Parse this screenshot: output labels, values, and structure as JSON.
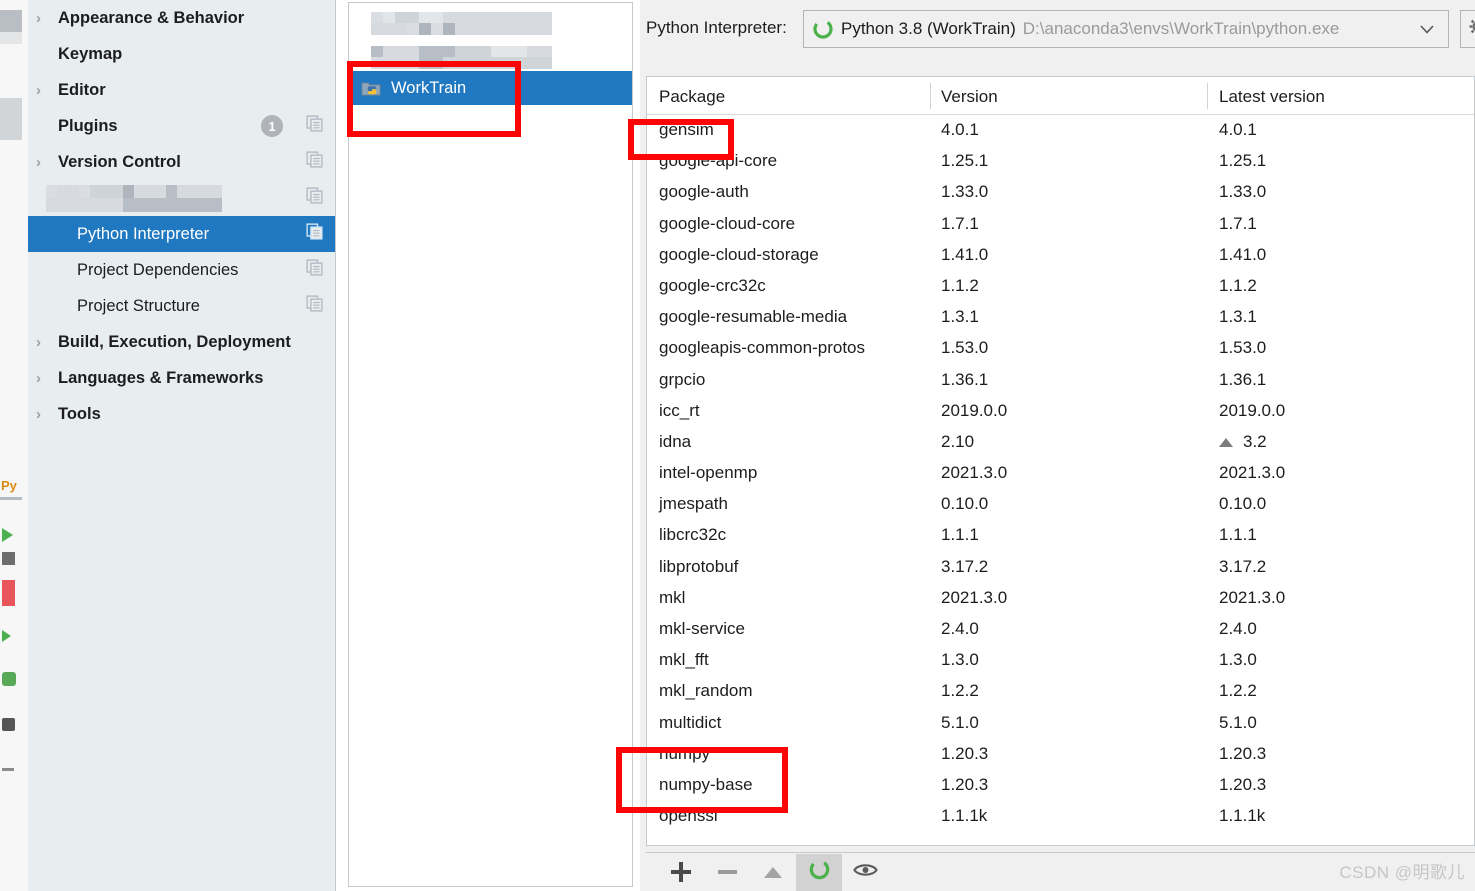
{
  "settings_tree": {
    "items": [
      {
        "label": "Appearance & Behavior",
        "level": "top",
        "expandable": true,
        "copy_icon": false,
        "badge": null,
        "redacted": false,
        "selected": false
      },
      {
        "label": "Keymap",
        "level": "top",
        "expandable": false,
        "copy_icon": false,
        "badge": null,
        "redacted": false,
        "selected": false
      },
      {
        "label": "Editor",
        "level": "top",
        "expandable": true,
        "copy_icon": false,
        "badge": null,
        "redacted": false,
        "selected": false
      },
      {
        "label": "Plugins",
        "level": "top",
        "expandable": false,
        "copy_icon": true,
        "badge": "1",
        "redacted": false,
        "selected": false
      },
      {
        "label": "Version Control",
        "level": "top",
        "expandable": true,
        "copy_icon": true,
        "badge": null,
        "redacted": false,
        "selected": false
      },
      {
        "label": "",
        "level": "top",
        "expandable": false,
        "copy_icon": true,
        "badge": null,
        "redacted": true,
        "selected": false
      },
      {
        "label": "Python Interpreter",
        "level": "child",
        "expandable": false,
        "copy_icon": true,
        "badge": null,
        "redacted": false,
        "selected": true
      },
      {
        "label": "Project Dependencies",
        "level": "child",
        "expandable": false,
        "copy_icon": true,
        "badge": null,
        "redacted": false,
        "selected": false
      },
      {
        "label": "Project Structure",
        "level": "child",
        "expandable": false,
        "copy_icon": true,
        "badge": null,
        "redacted": false,
        "selected": false
      },
      {
        "label": "Build, Execution, Deployment",
        "level": "top",
        "expandable": true,
        "copy_icon": false,
        "badge": null,
        "redacted": false,
        "selected": false
      },
      {
        "label": "Languages & Frameworks",
        "level": "top",
        "expandable": true,
        "copy_icon": false,
        "badge": null,
        "redacted": false,
        "selected": false
      },
      {
        "label": "Tools",
        "level": "top",
        "expandable": true,
        "copy_icon": false,
        "badge": null,
        "redacted": false,
        "selected": false
      }
    ],
    "chevron_glyph": "›"
  },
  "env_panel": {
    "items": [
      {
        "label": "",
        "redacted": true,
        "selected": false,
        "icon": null
      },
      {
        "label": "",
        "redacted": true,
        "selected": false,
        "icon": null
      },
      {
        "label": "WorkTrain",
        "redacted": false,
        "selected": true,
        "icon": "python-env-icon"
      }
    ]
  },
  "interpreter": {
    "label": "Python Interpreter:",
    "icon": "conda-ring-icon",
    "name": "Python 3.8 (WorkTrain)",
    "path": "D:\\anaconda3\\envs\\WorkTrain\\python.exe",
    "dropdown_arrow": "∨",
    "gear_button_icon": "gear-icon"
  },
  "packages_table": {
    "columns": [
      "Package",
      "Version",
      "Latest version"
    ],
    "rows": [
      {
        "package": "gensim",
        "version": "4.0.1",
        "latest": "4.0.1",
        "upgradable": false
      },
      {
        "package": "google-api-core",
        "version": "1.25.1",
        "latest": "1.25.1",
        "upgradable": false
      },
      {
        "package": "google-auth",
        "version": "1.33.0",
        "latest": "1.33.0",
        "upgradable": false
      },
      {
        "package": "google-cloud-core",
        "version": "1.7.1",
        "latest": "1.7.1",
        "upgradable": false
      },
      {
        "package": "google-cloud-storage",
        "version": "1.41.0",
        "latest": "1.41.0",
        "upgradable": false
      },
      {
        "package": "google-crc32c",
        "version": "1.1.2",
        "latest": "1.1.2",
        "upgradable": false
      },
      {
        "package": "google-resumable-media",
        "version": "1.3.1",
        "latest": "1.3.1",
        "upgradable": false
      },
      {
        "package": "googleapis-common-protos",
        "version": "1.53.0",
        "latest": "1.53.0",
        "upgradable": false
      },
      {
        "package": "grpcio",
        "version": "1.36.1",
        "latest": "1.36.1",
        "upgradable": false
      },
      {
        "package": "icc_rt",
        "version": "2019.0.0",
        "latest": "2019.0.0",
        "upgradable": false
      },
      {
        "package": "idna",
        "version": "2.10",
        "latest": "3.2",
        "upgradable": true
      },
      {
        "package": "intel-openmp",
        "version": "2021.3.0",
        "latest": "2021.3.0",
        "upgradable": false
      },
      {
        "package": "jmespath",
        "version": "0.10.0",
        "latest": "0.10.0",
        "upgradable": false
      },
      {
        "package": "libcrc32c",
        "version": "1.1.1",
        "latest": "1.1.1",
        "upgradable": false
      },
      {
        "package": "libprotobuf",
        "version": "3.17.2",
        "latest": "3.17.2",
        "upgradable": false
      },
      {
        "package": "mkl",
        "version": "2021.3.0",
        "latest": "2021.3.0",
        "upgradable": false
      },
      {
        "package": "mkl-service",
        "version": "2.4.0",
        "latest": "2.4.0",
        "upgradable": false
      },
      {
        "package": "mkl_fft",
        "version": "1.3.0",
        "latest": "1.3.0",
        "upgradable": false
      },
      {
        "package": "mkl_random",
        "version": "1.2.2",
        "latest": "1.2.2",
        "upgradable": false
      },
      {
        "package": "multidict",
        "version": "5.1.0",
        "latest": "5.1.0",
        "upgradable": false
      },
      {
        "package": "numpy",
        "version": "1.20.3",
        "latest": "1.20.3",
        "upgradable": false
      },
      {
        "package": "numpy-base",
        "version": "1.20.3",
        "latest": "1.20.3",
        "upgradable": false
      },
      {
        "package": "openssl",
        "version": "1.1.1k",
        "latest": "1.1.1k",
        "upgradable": false
      }
    ]
  },
  "bottom_toolbar": {
    "buttons": [
      {
        "name": "add-package-button",
        "icon": "plus-icon",
        "active": false
      },
      {
        "name": "remove-package-button",
        "icon": "minus-icon",
        "active": false
      },
      {
        "name": "upgrade-package-button",
        "icon": "triangle-up-icon",
        "active": false
      },
      {
        "name": "conda-button",
        "icon": "conda-ring-icon",
        "active": true
      },
      {
        "name": "show-early-releases-button",
        "icon": "eye-icon",
        "active": false
      }
    ]
  },
  "annotations": {
    "color": "#fc0505",
    "boxes": [
      {
        "name": "annot-worktrain",
        "target": "WorkTrain"
      },
      {
        "name": "annot-gensim",
        "target": "gensim"
      },
      {
        "name": "annot-numpy",
        "target": "numpy / numpy-base"
      }
    ]
  },
  "watermark": {
    "text": "CSDN @明歌儿"
  }
}
